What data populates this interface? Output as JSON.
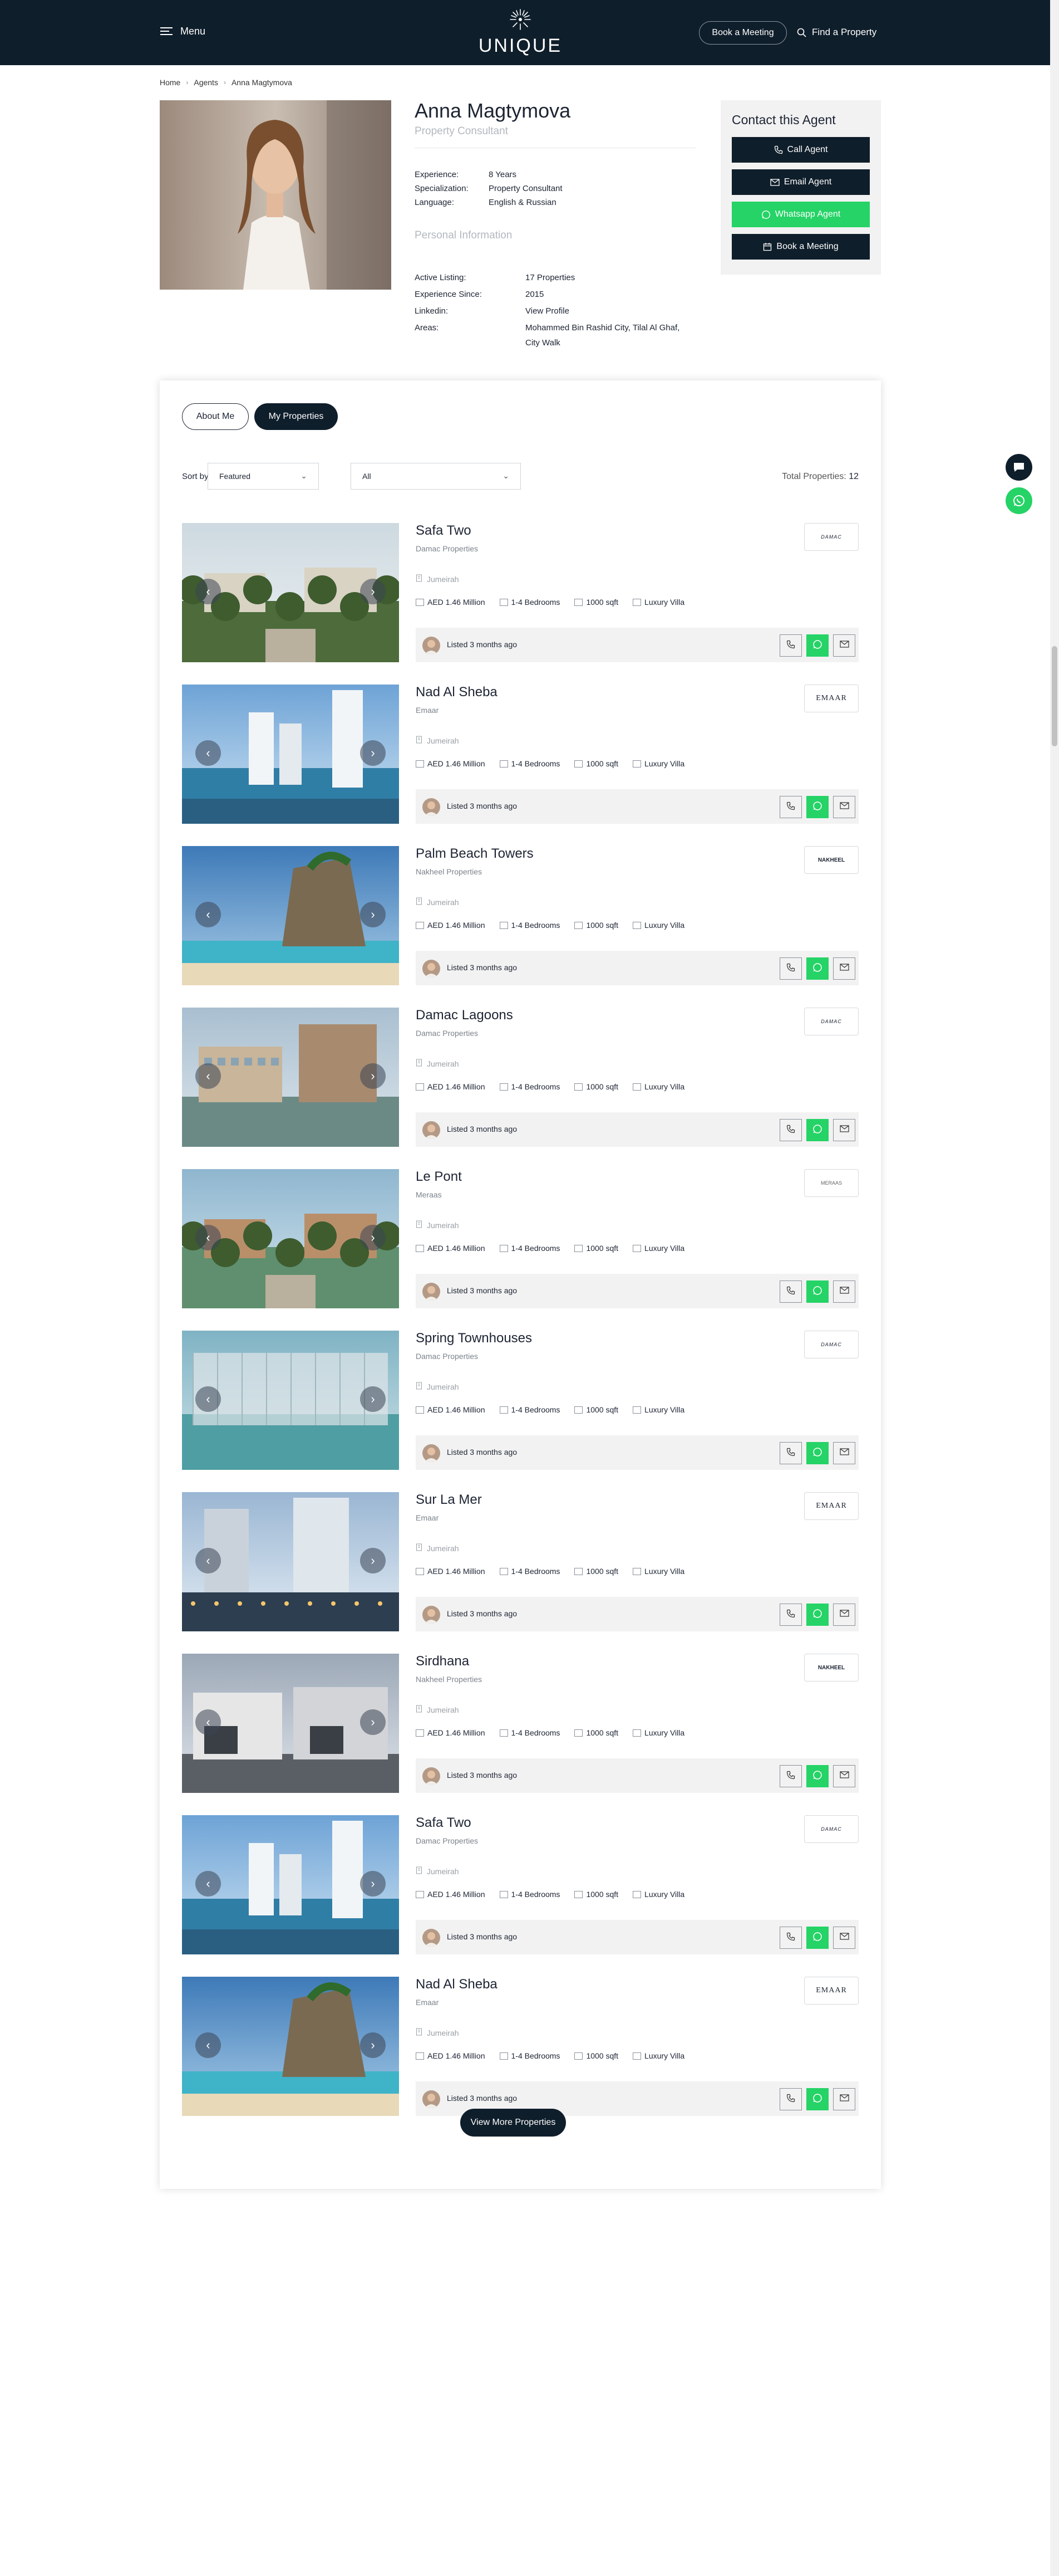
{
  "header": {
    "menu_label": "Menu",
    "logo_text": "UNIQUE",
    "book_meeting_label": "Book a Meeting",
    "find_property_label": "Find a Property"
  },
  "breadcrumb": [
    "Home",
    "Agents",
    "Anna Magtymova"
  ],
  "agent": {
    "name": "Anna Magtymova",
    "role": "Property Consultant",
    "details": [
      {
        "label": "Experience:",
        "value": "8 Years"
      },
      {
        "label": "Specialization:",
        "value": "Property Consultant"
      },
      {
        "label": "Language:",
        "value": "English & Russian"
      }
    ],
    "personal_title": "Personal Information",
    "personal": [
      {
        "label": "Active Listing:",
        "value": "17 Properties"
      },
      {
        "label": "Experience Since:",
        "value": "2015"
      },
      {
        "label": "Linkedin:",
        "value": "View Profile"
      },
      {
        "label": "Areas:",
        "value": "Mohammed Bin Rashid City, Tilal Al Ghaf,",
        "value2": "City Walk"
      }
    ]
  },
  "contact": {
    "title": "Contact this Agent",
    "buttons": [
      "Call Agent",
      "Email Agent",
      "Whatsapp Agent",
      "Book a Meeting"
    ]
  },
  "tabs": {
    "about": "About Me",
    "properties": "My Properties"
  },
  "filters": {
    "sort_label": "Sort by",
    "sort_value": "Featured",
    "filter_value": "All",
    "total_label": "Total Properties:",
    "total_value": "12"
  },
  "properties": [
    {
      "title": "Safa Two",
      "developer": "Damac Properties",
      "location": "Jumeirah",
      "price": "AED 1.46 Million",
      "bedrooms": "1-4 Bedrooms",
      "area": "1000 sqft",
      "type": "Luxury Villa",
      "listed": "Listed 3 months ago",
      "logo": "DAMAC"
    },
    {
      "title": "Nad Al Sheba",
      "developer": "Emaar",
      "location": "Jumeirah",
      "price": "AED 1.46 Million",
      "bedrooms": "1-4 Bedrooms",
      "area": "1000 sqft",
      "type": "Luxury Villa",
      "listed": "Listed 3 months ago",
      "logo": "EMAAR"
    },
    {
      "title": "Palm Beach Towers",
      "developer": "Nakheel Properties",
      "location": "Jumeirah",
      "price": "AED 1.46 Million",
      "bedrooms": "1-4 Bedrooms",
      "area": "1000 sqft",
      "type": "Luxury Villa",
      "listed": "Listed 3 months ago",
      "logo": "NAKHEEL"
    },
    {
      "title": "Damac Lagoons",
      "developer": "Damac Properties",
      "location": "Jumeirah",
      "price": "AED 1.46 Million",
      "bedrooms": "1-4 Bedrooms",
      "area": "1000 sqft",
      "type": "Luxury Villa",
      "listed": "Listed 3 months ago",
      "logo": "DAMAC"
    },
    {
      "title": "Le Pont",
      "developer": "Meraas",
      "location": "Jumeirah",
      "price": "AED 1.46 Million",
      "bedrooms": "1-4 Bedrooms",
      "area": "1000 sqft",
      "type": "Luxury Villa",
      "listed": "Listed 3 months ago",
      "logo": "MERAAS"
    },
    {
      "title": "Spring Townhouses",
      "developer": "Damac Properties",
      "location": "Jumeirah",
      "price": "AED 1.46 Million",
      "bedrooms": "1-4 Bedrooms",
      "area": "1000 sqft",
      "type": "Luxury Villa",
      "listed": "Listed 3 months ago",
      "logo": "DAMAC"
    },
    {
      "title": "Sur La Mer",
      "developer": "Emaar",
      "location": "Jumeirah",
      "price": "AED 1.46 Million",
      "bedrooms": "1-4 Bedrooms",
      "area": "1000 sqft",
      "type": "Luxury Villa",
      "listed": "Listed 3 months ago",
      "logo": "EMAAR"
    },
    {
      "title": "Sirdhana",
      "developer": "Nakheel Properties",
      "location": "Jumeirah",
      "price": "AED 1.46 Million",
      "bedrooms": "1-4 Bedrooms",
      "area": "1000 sqft",
      "type": "Luxury Villa",
      "listed": "Listed 3 months ago",
      "logo": "NAKHEEL"
    },
    {
      "title": "Safa Two",
      "developer": "Damac Properties",
      "location": "Jumeirah",
      "price": "AED 1.46 Million",
      "bedrooms": "1-4 Bedrooms",
      "area": "1000 sqft",
      "type": "Luxury Villa",
      "listed": "Listed 3 months ago",
      "logo": "DAMAC"
    },
    {
      "title": "Nad Al Sheba",
      "developer": "Emaar",
      "location": "Jumeirah",
      "price": "AED 1.46 Million",
      "bedrooms": "1-4 Bedrooms",
      "area": "1000 sqft",
      "type": "Luxury Villa",
      "listed": "Listed 3 months ago",
      "logo": "EMAAR"
    }
  ],
  "view_more_label": "View More Properties",
  "colors": {
    "navy": "#0f1e2b",
    "whatsapp": "#25d366",
    "panel_grey": "#f2f2f2"
  }
}
